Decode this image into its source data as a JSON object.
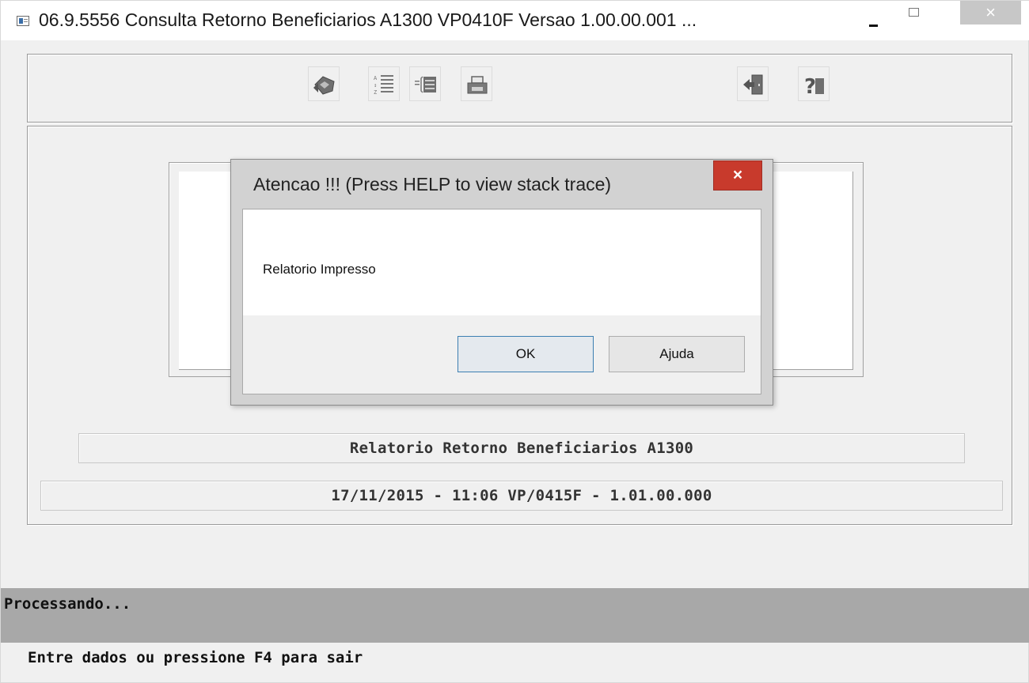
{
  "window": {
    "title": "06.9.5556  Consulta Retorno Beneficiarios A1300 VP0410F Versao 1.00.00.001 ...",
    "close_glyph": "×"
  },
  "toolbar": {
    "buttons": [
      {
        "icon": "execute-icon"
      },
      {
        "icon": "sort-az-icon"
      },
      {
        "icon": "list-icon"
      },
      {
        "icon": "printer-icon"
      },
      {
        "icon": "exit-door-icon"
      },
      {
        "icon": "help-question-icon"
      }
    ]
  },
  "report": {
    "title": "Relatorio Retorno Beneficiarios A1300",
    "info": "17/11/2015 - 11:06  VP/0415F - 1.01.00.000"
  },
  "status": {
    "text": "Processando...",
    "message": "Entre dados ou pressione F4 para sair"
  },
  "dialog": {
    "title": "Atencao !!! (Press HELP to view stack trace)",
    "close_glyph": "×",
    "message": "Relatorio Impresso",
    "ok_label": "OK",
    "help_label": "Ajuda"
  },
  "colors": {
    "close_red": "#c83a2c",
    "status_bar": "#a8a8a8",
    "ok_border": "#3c7fb1"
  }
}
